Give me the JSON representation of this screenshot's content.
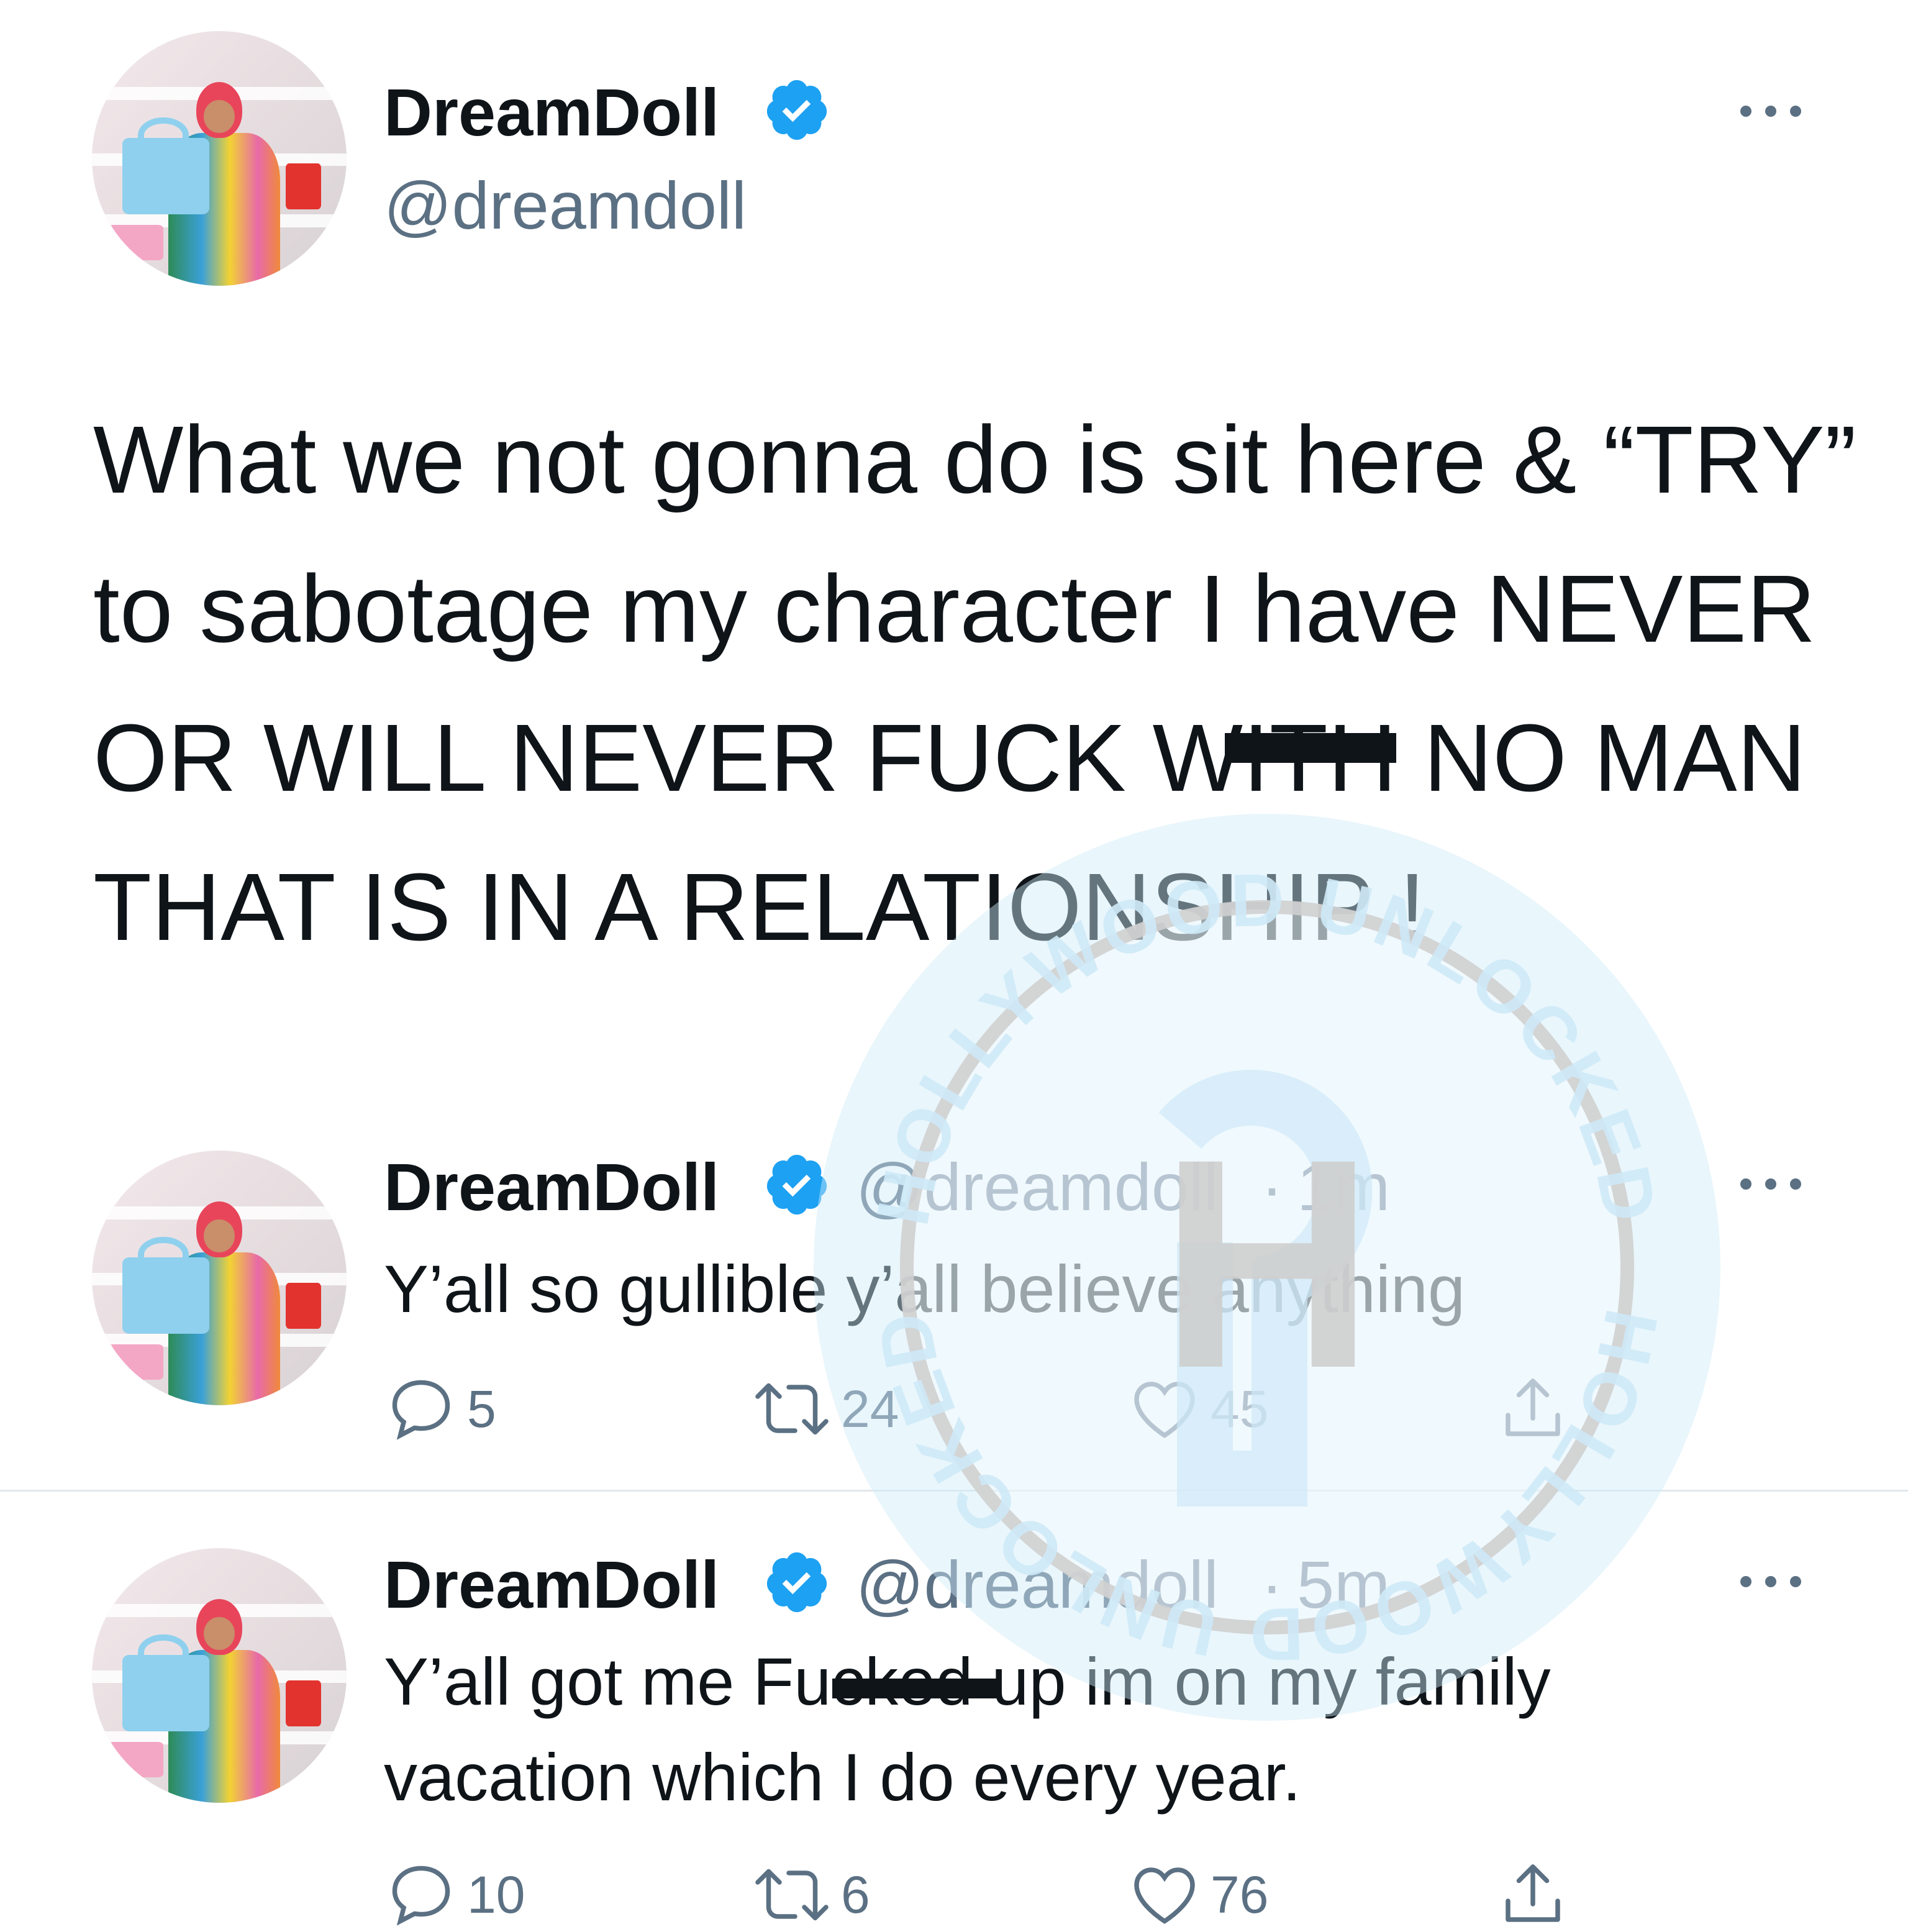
{
  "main_tweet": {
    "author_name": "DreamDoll",
    "handle": "@dreamdoll",
    "text": "What we not gonna do is sit here & “TRY” to sabotage my character I have NEVER OR WILL NEVER FUCK WITH NO MAN THAT IS IN A RELATIONSHIP !"
  },
  "replies": [
    {
      "author_name": "DreamDoll",
      "handle": "@dreamdoll",
      "separator": "·",
      "time": "1m",
      "lines": [
        "Y’all so gullible y’all believe anything"
      ],
      "counts": {
        "replies": "5",
        "retweets": "24",
        "likes": "45"
      }
    },
    {
      "author_name": "DreamDoll",
      "handle": "@dreamdoll",
      "separator": "·",
      "time": "5m",
      "lines": [
        "Y’all got me Fucked up im on my family",
        "vacation which I do every year."
      ],
      "counts": {
        "replies": "10",
        "retweets": "6",
        "likes": "76"
      }
    }
  ],
  "watermark": {
    "text_top": "HOLLYWOOD UNLOCKED",
    "text_bottom": "HOLLYWOOD UNLOCKED",
    "monogram": "H"
  },
  "icons": {
    "verified": "verified-badge-icon",
    "more": "more-options-icon",
    "reply": "reply-icon",
    "retweet": "retweet-icon",
    "like": "heart-icon",
    "share": "share-icon"
  },
  "colors": {
    "text": "#0f1419",
    "secondary": "#5b7083",
    "verified": "#1da1f2",
    "divider": "#e1e8ed",
    "watermark_blue": "#cfeaf8",
    "watermark_gray": "#cfcfcf"
  }
}
